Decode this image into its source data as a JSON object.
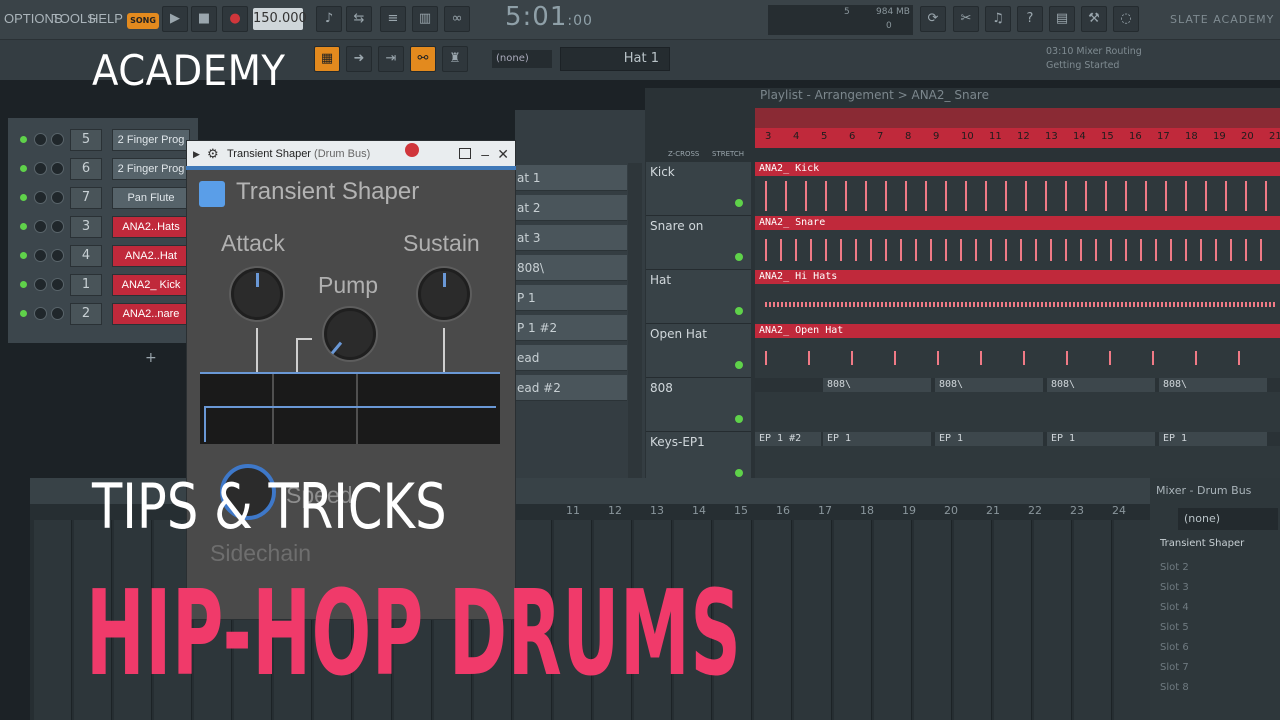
{
  "menubar": {
    "items": [
      "OPTIONS",
      "TOOLS",
      "HELP"
    ],
    "song_label": "SONG",
    "tempo": "150.000",
    "time_main": "5:01",
    "time_sub": ":00",
    "cpu_ram": "984 MB",
    "cpu_val": "5",
    "cpu_zero": "0",
    "brand": "SLATE ACADEMY"
  },
  "toolbar2": {
    "pattern": "(none)",
    "channel": "Hat 1",
    "hint_line1": "03:10  Mixer Routing",
    "hint_line2": "Getting Started"
  },
  "channel_rack": {
    "rows": [
      {
        "num": "5",
        "name": "2 Finger Prog",
        "red": false
      },
      {
        "num": "6",
        "name": "2 Finger Prog",
        "red": false
      },
      {
        "num": "7",
        "name": "Pan Flute",
        "red": false
      },
      {
        "num": "3",
        "name": "ANA2..Hats",
        "red": true
      },
      {
        "num": "4",
        "name": "ANA2..Hat",
        "red": true
      },
      {
        "num": "1",
        "name": "ANA2_ Kick",
        "red": true
      },
      {
        "num": "2",
        "name": "ANA2..nare",
        "red": true
      }
    ],
    "add": "+"
  },
  "plugin": {
    "title": "Transient Shaper",
    "subtitle": "(Drum Bus)",
    "name": "Transient Shaper",
    "attack": "Attack",
    "sustain": "Sustain",
    "pump": "Pump",
    "speed": "Speed",
    "sidechain": "Sidechain"
  },
  "browser": {
    "items": [
      "at 1",
      "at 2",
      "at 3",
      "808\\",
      "P 1",
      "P 1 #2",
      "ead",
      "ead #2"
    ]
  },
  "playlist": {
    "title": "Playlist - Arrangement > ANA2_ Snare",
    "zcross": "Z-CROSS",
    "stretch": "STRETCH",
    "ruler": [
      "3",
      "4",
      "5",
      "6",
      "7",
      "8",
      "9",
      "10",
      "11",
      "12",
      "13",
      "14",
      "15",
      "16",
      "17",
      "18",
      "19",
      "20",
      "21"
    ],
    "tracks": [
      {
        "label": "Kick",
        "clip": "ANA2_ Kick"
      },
      {
        "label": "Snare on",
        "clip": "ANA2_ Snare"
      },
      {
        "label": "Hat",
        "clip": "ANA2_ Hi Hats"
      },
      {
        "label": "Open Hat",
        "clip": "ANA2_ Open Hat"
      },
      {
        "label": "808",
        "clip": "808\\"
      },
      {
        "label": "Keys-EP1",
        "clip": "EP 1 #2"
      }
    ],
    "clip_808": "808\\",
    "clip_ep": "EP 1"
  },
  "mixer": {
    "title": "Mixer - Drum Bus",
    "none": "(none)",
    "slot_active": "Transient Shaper",
    "slots": [
      "Slot 2",
      "Slot 3",
      "Slot 4",
      "Slot 5",
      "Slot 6",
      "Slot 7",
      "Slot 8"
    ],
    "numbers": [
      "11",
      "12",
      "13",
      "14",
      "15",
      "16",
      "17",
      "18",
      "19",
      "20",
      "21",
      "22",
      "23",
      "24"
    ]
  },
  "overlay": {
    "academy": "ACADEMY",
    "tips": "TIPS & TRICKS",
    "headline": "HIP-HOP DRUMS"
  },
  "colors": {
    "accent_pink": "#f03a6a",
    "clip_red": "#c0293b",
    "plugin_blue": "#5a9ee8",
    "led_green": "#5fd24a"
  }
}
